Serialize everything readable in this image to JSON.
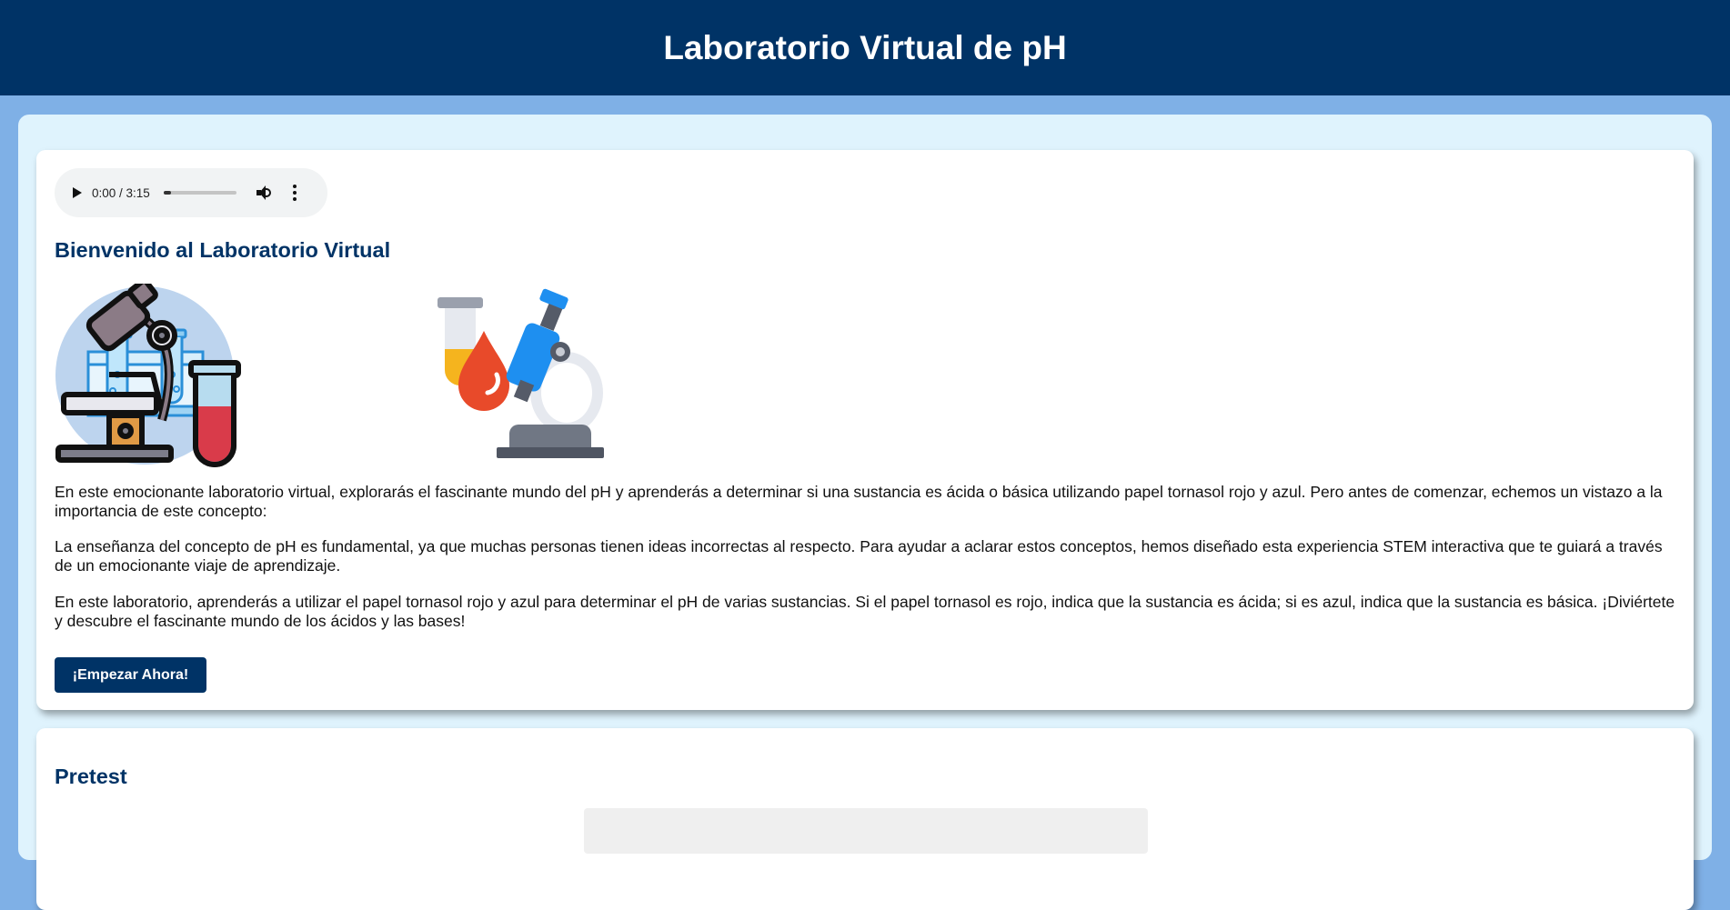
{
  "header": {
    "title": "Laboratorio Virtual de pH"
  },
  "audio": {
    "time": "0:00 / 3:15",
    "progress": 0.02
  },
  "welcome": {
    "title": "Bienvenido al Laboratorio Virtual",
    "paragraphs": [
      "En este emocionante laboratorio virtual, explorarás el fascinante mundo del pH y aprenderás a determinar si una sustancia es ácida o básica utilizando papel tornasol rojo y azul. Pero antes de comenzar, echemos un vistazo a la importancia de este concepto:",
      "La enseñanza del concepto de pH es fundamental, ya que muchas personas tienen ideas incorrectas al respecto. Para ayudar a aclarar estos conceptos, hemos diseñado esta experiencia STEM interactiva que te guiará a través de un emocionante viaje de aprendizaje.",
      "En este laboratorio, aprenderás a utilizar el papel tornasol rojo y azul para determinar el pH de varias sustancias. Si el papel tornasol es rojo, indica que la sustancia es ácida; si es azul, indica que la sustancia es básica. ¡Diviértete y descubre el fascinante mundo de los ácidos y las bases!"
    ],
    "start_button": "¡Empezar Ahora!",
    "images": [
      "test-tubes-rack-icon",
      "microscope-icon",
      "lab-equipment-icon"
    ]
  },
  "pretest": {
    "title": "Pretest"
  },
  "colors": {
    "header_bg": "#003366",
    "page_bg": "#7fb0e6",
    "panel_bg": "#dff3fd",
    "accent": "#003366"
  }
}
